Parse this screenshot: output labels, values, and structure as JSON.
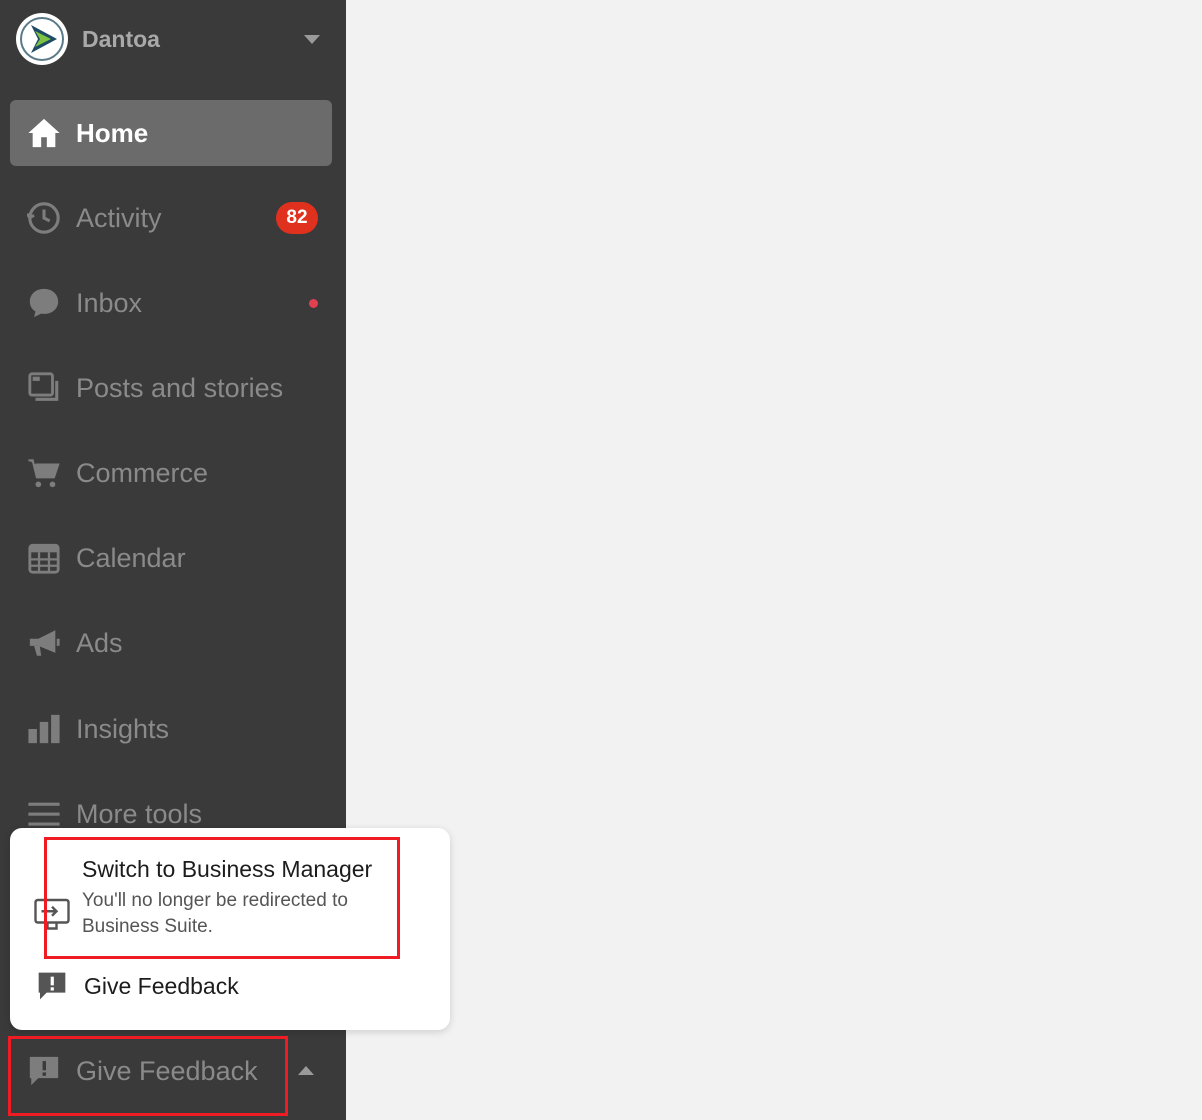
{
  "account": {
    "name": "Dantoa",
    "logo_icon": "dantoa-logo-icon"
  },
  "nav": {
    "items": [
      {
        "label": "Home",
        "icon": "home-icon",
        "active": true
      },
      {
        "label": "Activity",
        "icon": "activity-icon",
        "badge": "82"
      },
      {
        "label": "Inbox",
        "icon": "inbox-icon",
        "unread_dot": true
      },
      {
        "label": "Posts and stories",
        "icon": "posts-icon"
      },
      {
        "label": "Commerce",
        "icon": "cart-icon"
      },
      {
        "label": "Calendar",
        "icon": "calendar-icon"
      },
      {
        "label": "Ads",
        "icon": "megaphone-icon"
      },
      {
        "label": "Insights",
        "icon": "bar-chart-icon"
      },
      {
        "label": "More tools",
        "icon": "menu-icon"
      }
    ],
    "footer": {
      "label": "Give Feedback",
      "icon": "feedback-icon"
    }
  },
  "popup": {
    "switch": {
      "title": "Switch to Business Manager",
      "description": "You'll no longer be redirected to Business Suite."
    },
    "feedback": {
      "label": "Give Feedback"
    }
  },
  "colors": {
    "sidebar_bg": "#3a3a3a",
    "active_item_bg": "#6b6b6b",
    "badge": "#e0311f",
    "highlight": "#ef1c24",
    "page_bg": "#f2f2f2"
  }
}
